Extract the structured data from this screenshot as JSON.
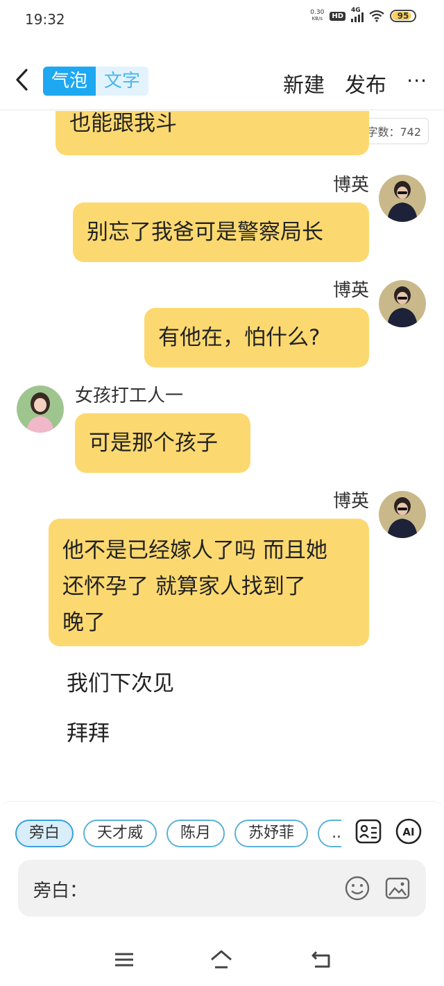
{
  "status_bar": {
    "time": "19:32",
    "net_speed_value": "0.30",
    "net_speed_unit": "KB/s",
    "hd": "HD",
    "network": "4G",
    "battery": "95"
  },
  "header": {
    "mode_bubble": "气泡",
    "mode_text": "文字",
    "new_label": "新建",
    "publish_label": "发布",
    "more_label": "···"
  },
  "chat": {
    "word_count": "字数：742",
    "messages": [
      {
        "sender": "",
        "text": "也能跟我斗"
      },
      {
        "sender": "博英",
        "text": "别忘了我爸可是警察局长"
      },
      {
        "sender": "博英",
        "text": "有他在，怕什么?"
      },
      {
        "sender": "女孩打工人一",
        "text": "可是那个孩子"
      },
      {
        "sender": "博英",
        "line1": "他不是已经嫁人了吗 而且她",
        "line2": "还怀孕了 就算家人找到了",
        "line3": "晚了"
      }
    ],
    "narration": [
      "我们下次见",
      "拜拜"
    ]
  },
  "composer": {
    "chips": [
      "旁白",
      "天才威",
      "陈月",
      "苏妤菲",
      "..."
    ],
    "input_prefix": "旁白："
  },
  "colors": {
    "bubble": "#fcd970",
    "accent": "#1fa8f2"
  }
}
